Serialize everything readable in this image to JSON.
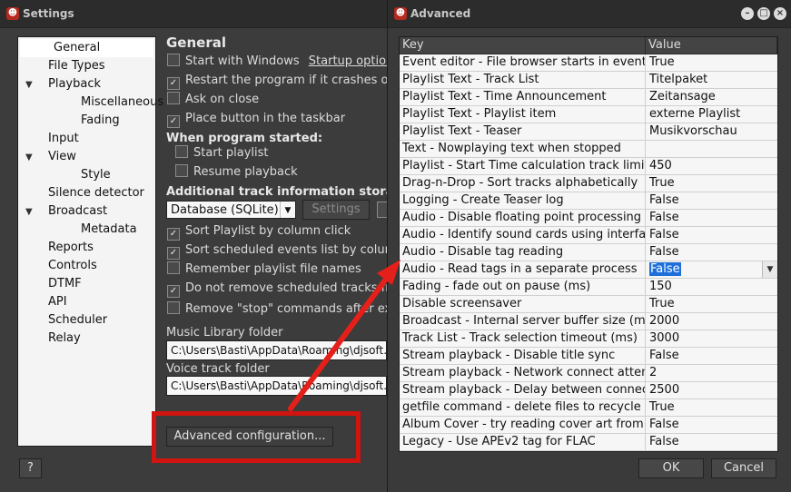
{
  "settings": {
    "title": "Settings",
    "tree": [
      {
        "label": "General",
        "expander": ""
      },
      {
        "label": "File Types",
        "expander": ""
      },
      {
        "label": "Playback",
        "expander": "▼"
      },
      {
        "label": "Miscellaneous",
        "expander": ""
      },
      {
        "label": "Fading",
        "expander": ""
      },
      {
        "label": "Input",
        "expander": ""
      },
      {
        "label": "View",
        "expander": "▼"
      },
      {
        "label": "Style",
        "expander": ""
      },
      {
        "label": "Silence detector",
        "expander": ""
      },
      {
        "label": "Broadcast",
        "expander": "▼"
      },
      {
        "label": "Metadata",
        "expander": ""
      },
      {
        "label": "Reports",
        "expander": ""
      },
      {
        "label": "Controls",
        "expander": ""
      },
      {
        "label": "DTMF",
        "expander": ""
      },
      {
        "label": "API",
        "expander": ""
      },
      {
        "label": "Scheduler",
        "expander": ""
      },
      {
        "label": "Relay",
        "expander": ""
      }
    ],
    "panel_title": "General",
    "start_with_windows": {
      "label": "Start with Windows",
      "checked": false,
      "link": "Startup options"
    },
    "restart_on_crash": {
      "label": "Restart the program if it crashes or ha",
      "checked": true
    },
    "ask_on_close": {
      "label": "Ask on close",
      "checked": false
    },
    "taskbar_button": {
      "label": "Place button in the taskbar",
      "checked": true
    },
    "when_started_title": "When program started:",
    "start_playlist": {
      "label": "Start playlist",
      "checked": false
    },
    "resume_playback": {
      "label": "Resume playback",
      "checked": false
    },
    "storage_title": "Additional track information storage loc",
    "storage_value": "Database (SQLite)",
    "storage_settings_button": "Settings",
    "sort_playlist": {
      "label": "Sort Playlist by column click",
      "checked": true
    },
    "sort_scheduled": {
      "label": "Sort scheduled events list by column c",
      "checked": true
    },
    "remember_names": {
      "label": "Remember playlist file names",
      "checked": false
    },
    "no_remove_scheduled": {
      "label": "Do not remove scheduled tracks from",
      "checked": true
    },
    "remove_stop": {
      "label": "Remove \"stop\" commands after execu",
      "checked": false
    },
    "music_library_label": "Music Library folder",
    "music_library_value": "C:\\Users\\Basti\\AppData\\Roaming\\djsoft.",
    "voice_track_label": "Voice track folder",
    "voice_track_value": "C:\\Users\\Basti\\AppData\\Roaming\\djsoft.",
    "advanced_button": "Advanced configuration...",
    "help_button": "?"
  },
  "advanced": {
    "title": "Advanced",
    "window_buttons": [
      "–",
      "□",
      "×"
    ],
    "columns": {
      "key": "Key",
      "value": "Value"
    },
    "rows": [
      {
        "key": "Event editor - File browser starts in event dire",
        "value": "True"
      },
      {
        "key": "Playlist Text - Track List",
        "value": "Titelpaket"
      },
      {
        "key": "Playlist Text - Time Announcement",
        "value": "Zeitansage"
      },
      {
        "key": "Playlist Text - Playlist item",
        "value": "externe Playlist"
      },
      {
        "key": "Playlist Text - Teaser",
        "value": "Musikvorschau"
      },
      {
        "key": "Text - Nowplaying text when stopped",
        "value": ""
      },
      {
        "key": "Playlist - Start Time calculation track limit",
        "value": "450"
      },
      {
        "key": "Drag-n-Drop - Sort tracks alphabetically",
        "value": "True"
      },
      {
        "key": "Logging - Create Teaser log",
        "value": "False"
      },
      {
        "key": "Audio - Disable floating point processing",
        "value": "False"
      },
      {
        "key": "Audio - Identify sound cards using interface na",
        "value": "False"
      },
      {
        "key": "Audio - Disable tag reading",
        "value": "False"
      },
      {
        "key": "Audio - Read tags in a separate process",
        "value": "False"
      },
      {
        "key": "Fading - fade out on pause (ms)",
        "value": "150"
      },
      {
        "key": "Disable screensaver",
        "value": "True"
      },
      {
        "key": "Broadcast - Internal server buffer size (ms)",
        "value": "2000"
      },
      {
        "key": "Track List - Track selection timeout (ms)",
        "value": "3000"
      },
      {
        "key": "Stream playback - Disable title sync",
        "value": "False"
      },
      {
        "key": "Stream playback - Network connect attempts",
        "value": "2"
      },
      {
        "key": "Stream playback - Delay between connect att",
        "value": "2500"
      },
      {
        "key": "getfile command - delete files to recycle bin",
        "value": "True"
      },
      {
        "key": "Album Cover - try reading cover art from folde",
        "value": "False"
      },
      {
        "key": "Legacy - Use APEv2 tag for FLAC",
        "value": "False"
      }
    ],
    "selected_row_index": 12,
    "ok_button": "OK",
    "cancel_button": "Cancel"
  },
  "colors": {
    "highlight_box": "#d0140f",
    "arrow": "#e5201a",
    "selection": "#1e6fd9"
  }
}
